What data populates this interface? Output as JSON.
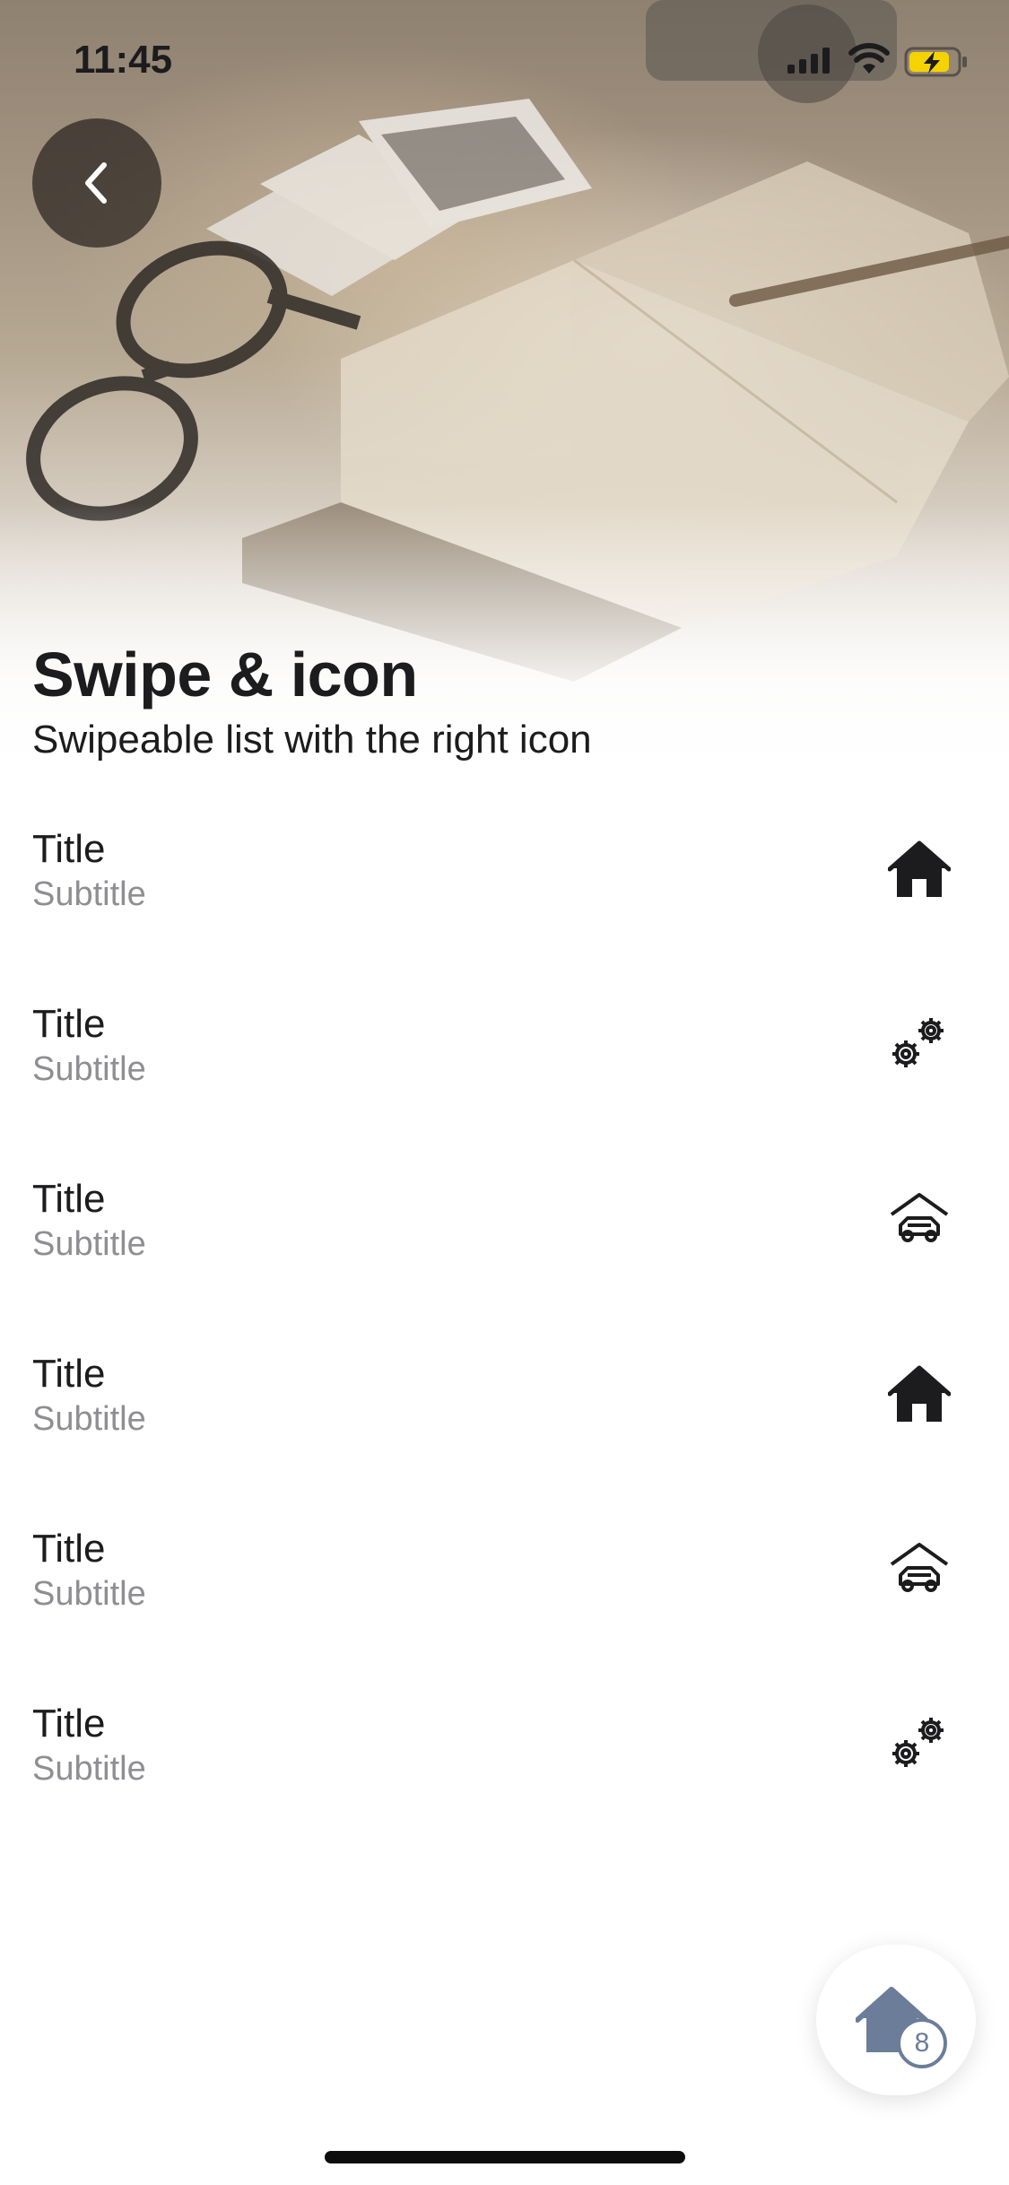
{
  "status_bar": {
    "time": "11:45",
    "battery_color": "#f5d300"
  },
  "header": {
    "title": "Swipe & icon",
    "subtitle": "Swipeable list with the right icon"
  },
  "list": {
    "items": [
      {
        "title": "Title",
        "subtitle": "Subtitle",
        "icon": "house-icon"
      },
      {
        "title": "Title",
        "subtitle": "Subtitle",
        "icon": "gears-icon"
      },
      {
        "title": "Title",
        "subtitle": "Subtitle",
        "icon": "garage-car-icon"
      },
      {
        "title": "Title",
        "subtitle": "Subtitle",
        "icon": "house-icon"
      },
      {
        "title": "Title",
        "subtitle": "Subtitle",
        "icon": "garage-car-icon"
      },
      {
        "title": "Title",
        "subtitle": "Subtitle",
        "icon": "gears-icon"
      }
    ]
  },
  "fab": {
    "icon": "house-icon",
    "badge": "8",
    "color": "#6b7d99"
  }
}
